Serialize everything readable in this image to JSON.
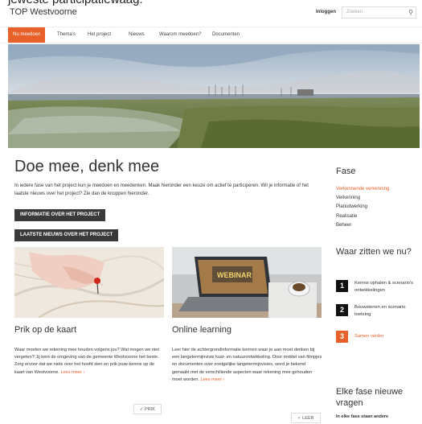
{
  "cut_text": "jeweste participatiewaag.",
  "header": {
    "site_title": "TOP Westvoorne",
    "login_label": "Inloggen",
    "search_placeholder": "Zoeken"
  },
  "nav": {
    "items": [
      "Nu meedoen",
      "Thema's",
      "Het project",
      "Nieuws",
      "Waarom meedoen?",
      "Documenten"
    ],
    "active_index": 0
  },
  "main": {
    "title": "Doe mee, denk mee",
    "intro": "In iedere fase van het project kun je meedoen en meedenken. Maak hieronder een keuze om actief te participeren. Wil je informatie of het laatste nieuws over het project? Zie dan de knoppen hieronder.",
    "buttons": [
      "Informatie over het project",
      "Laatste nieuws over het project"
    ]
  },
  "cards": [
    {
      "title": "Prik op de kaart",
      "text": "Waar moeten we rekening mee houden volgens jou? Wat mogen we niet vergeten? Jij kent de omgeving van de gemeente Westvoorne het beste. Zorg ervoor dat we niets over het hoofd zien en prik jouw kennis op de kaart van Westvoorne.",
      "more": "Lees meer ›",
      "button": "✓ PRIK"
    },
    {
      "title": "Online learning",
      "image_label": "WEBINAR",
      "text": "Leer hier de achtergrondinformatie kennen waar je aan moet denken bij een langetermijnvisie kust- en natuurontwikkeling. Door middel van filmpjes en documenten over zoetgelijke langetermijnvisies, word je bekend gemaakt met de verschillende aspecten waar rekening mee gehouden moet worden.",
      "more": "Lees meer ›",
      "button": "✓ LEER"
    }
  ],
  "sidebar": {
    "fase_title": "Fase",
    "phases": [
      "Verkennende verkenning",
      "Verkenning",
      "Planuitwerking",
      "Realisatie",
      "Beheer"
    ],
    "active_phase": 0,
    "where_title": "Waar zitten we nu?",
    "steps": [
      {
        "num": "1",
        "text": "Kennis ophalen & scenario's ontwikkelingen"
      },
      {
        "num": "2",
        "text": "Bouwstenen en scenario toetsing"
      },
      {
        "num": "3",
        "text": "Samen verder"
      }
    ],
    "each_title": "Elke fase nieuwe vragen",
    "each_text": "In elke fase staan andere"
  },
  "colors": {
    "accent": "#e8612a",
    "dark_button": "#3a3a3a"
  }
}
